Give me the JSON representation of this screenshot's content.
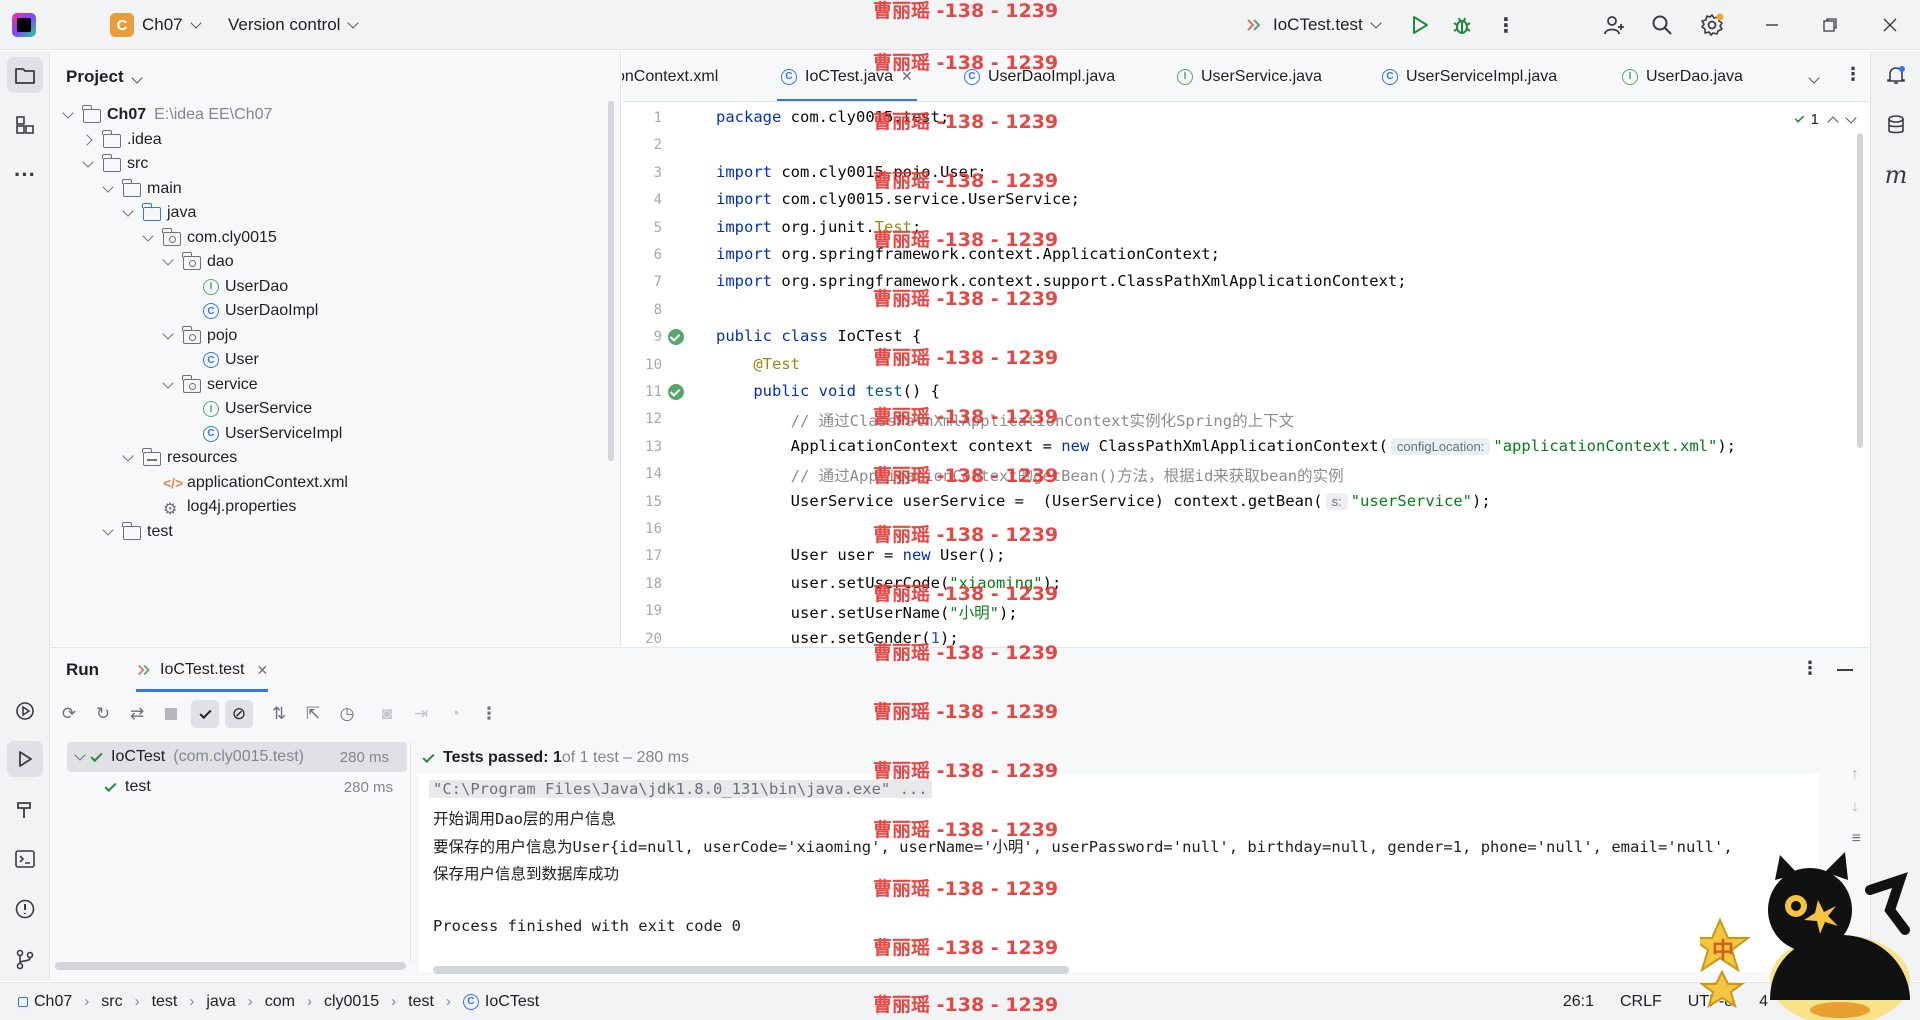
{
  "titlebar": {
    "project_badge": "C",
    "project_name": "Ch07",
    "vcs_label": "Version control",
    "run_config": "IoCTest.test"
  },
  "project_panel": {
    "title": "Project",
    "tree": [
      {
        "label": "Ch07",
        "extra": "E:\\idea EE\\Ch07",
        "icon": "folder",
        "expanded": true,
        "depth": 0
      },
      {
        "label": ".idea",
        "icon": "folder",
        "expanded": false,
        "depth": 1
      },
      {
        "label": "src",
        "icon": "folder",
        "expanded": true,
        "depth": 1
      },
      {
        "label": "main",
        "icon": "folder",
        "expanded": true,
        "depth": 2
      },
      {
        "label": "java",
        "icon": "folder-blue",
        "expanded": true,
        "depth": 3
      },
      {
        "label": "com.cly0015",
        "icon": "package",
        "expanded": true,
        "depth": 4
      },
      {
        "label": "dao",
        "icon": "package",
        "expanded": true,
        "depth": 5
      },
      {
        "label": "UserDao",
        "icon": "interface",
        "depth": 6
      },
      {
        "label": "UserDaoImpl",
        "icon": "class",
        "depth": 6
      },
      {
        "label": "pojo",
        "icon": "package",
        "expanded": true,
        "depth": 5
      },
      {
        "label": "User",
        "icon": "class",
        "depth": 6
      },
      {
        "label": "service",
        "icon": "package",
        "expanded": true,
        "depth": 5
      },
      {
        "label": "UserService",
        "icon": "interface",
        "depth": 6
      },
      {
        "label": "UserServiceImpl",
        "icon": "class",
        "depth": 6
      },
      {
        "label": "resources",
        "icon": "resources",
        "expanded": true,
        "depth": 3
      },
      {
        "label": "applicationContext.xml",
        "icon": "xml",
        "depth": 4
      },
      {
        "label": "log4j.properties",
        "icon": "gear",
        "depth": 4
      },
      {
        "label": "test",
        "icon": "folder",
        "expanded": true,
        "depth": 2
      }
    ]
  },
  "editor_tabs": [
    {
      "label": "onContext.xml",
      "icon": "xml",
      "active": false
    },
    {
      "label": "IoCTest.java",
      "icon": "class",
      "active": true
    },
    {
      "label": "UserDaoImpl.java",
      "icon": "class",
      "active": false
    },
    {
      "label": "UserService.java",
      "icon": "interface",
      "active": false
    },
    {
      "label": "UserServiceImpl.java",
      "icon": "class",
      "active": false
    },
    {
      "label": "UserDao.java",
      "icon": "interface",
      "active": false
    }
  ],
  "editor": {
    "inspection_count": "1",
    "line_numbers": [
      "1",
      "2",
      "3",
      "4",
      "5",
      "6",
      "7",
      "8",
      "9",
      "10",
      "11",
      "12",
      "13",
      "14",
      "15",
      "16",
      "17",
      "18",
      "19",
      "20"
    ],
    "lines": [
      {
        "indent": 0,
        "tokens": [
          {
            "t": "kw",
            "v": "package"
          },
          {
            "t": "p",
            "v": " com.cly0015.test;"
          }
        ]
      },
      {
        "indent": 0,
        "tokens": []
      },
      {
        "indent": 0,
        "tokens": [
          {
            "t": "kw",
            "v": "import"
          },
          {
            "t": "p",
            "v": " com.cly0015.pojo.User;"
          }
        ]
      },
      {
        "indent": 0,
        "tokens": [
          {
            "t": "kw",
            "v": "import"
          },
          {
            "t": "p",
            "v": " com.cly0015.service.UserService;"
          }
        ]
      },
      {
        "indent": 0,
        "tokens": [
          {
            "t": "kw",
            "v": "import"
          },
          {
            "t": "p",
            "v": " org.junit."
          },
          {
            "t": "ann",
            "v": "Test"
          },
          {
            "t": "p",
            "v": ";"
          }
        ]
      },
      {
        "indent": 0,
        "tokens": [
          {
            "t": "kw",
            "v": "import"
          },
          {
            "t": "p",
            "v": " org.springframework.context.ApplicationContext;"
          }
        ]
      },
      {
        "indent": 0,
        "tokens": [
          {
            "t": "kw",
            "v": "import"
          },
          {
            "t": "p",
            "v": " org.springframework.context.support.ClassPathXmlApplicationContext;"
          }
        ]
      },
      {
        "indent": 0,
        "tokens": []
      },
      {
        "indent": 0,
        "tokens": [
          {
            "t": "kw",
            "v": "public class"
          },
          {
            "t": "p",
            "v": " IoCTest {"
          }
        ]
      },
      {
        "indent": 1,
        "tokens": [
          {
            "t": "ann",
            "v": "@Test"
          }
        ]
      },
      {
        "indent": 1,
        "tokens": [
          {
            "t": "kw",
            "v": "public void"
          },
          {
            "t": "p",
            "v": " "
          },
          {
            "t": "fn",
            "v": "test"
          },
          {
            "t": "p",
            "v": "() {"
          }
        ]
      },
      {
        "indent": 2,
        "tokens": [
          {
            "t": "cmt",
            "v": "// 通过ClassPathXmlApplicationContext实例化Spring的上下文"
          }
        ]
      },
      {
        "indent": 2,
        "tokens": [
          {
            "t": "p",
            "v": "ApplicationContext context = "
          },
          {
            "t": "kw",
            "v": "new"
          },
          {
            "t": "p",
            "v": " ClassPathXmlApplicationContext("
          },
          {
            "t": "hint",
            "v": "configLocation:"
          },
          {
            "t": "str",
            "v": "\"applicationContext.xml\""
          },
          {
            "t": "p",
            "v": ");"
          }
        ]
      },
      {
        "indent": 2,
        "tokens": [
          {
            "t": "cmt",
            "v": "// 通过ApplicationContext的getBean()方法，根据id来获取bean的实例"
          }
        ]
      },
      {
        "indent": 2,
        "tokens": [
          {
            "t": "p",
            "v": "UserService userService =  (UserService) context.getBean("
          },
          {
            "t": "hint",
            "v": "s:"
          },
          {
            "t": "str",
            "v": "\"userService\""
          },
          {
            "t": "p",
            "v": ");"
          }
        ]
      },
      {
        "indent": 0,
        "tokens": []
      },
      {
        "indent": 2,
        "tokens": [
          {
            "t": "p",
            "v": "User user = "
          },
          {
            "t": "kw",
            "v": "new"
          },
          {
            "t": "p",
            "v": " User();"
          }
        ]
      },
      {
        "indent": 2,
        "tokens": [
          {
            "t": "p",
            "v": "user.setUserCode("
          },
          {
            "t": "str",
            "v": "\"xiaoming\""
          },
          {
            "t": "p",
            "v": ");"
          }
        ]
      },
      {
        "indent": 2,
        "tokens": [
          {
            "t": "p",
            "v": "user.setUserName("
          },
          {
            "t": "str",
            "v": "\"小明\""
          },
          {
            "t": "p",
            "v": ");"
          }
        ]
      },
      {
        "indent": 2,
        "tokens": [
          {
            "t": "p",
            "v": "user.setGender("
          },
          {
            "t": "num",
            "v": "1"
          },
          {
            "t": "p",
            "v": ");"
          }
        ]
      }
    ]
  },
  "run_panel": {
    "title": "Run",
    "tab_label": "IoCTest.test",
    "results": [
      {
        "name": "IoCTest",
        "detail": "(com.cly0015.test)",
        "duration": "280 ms"
      },
      {
        "name": "test",
        "detail": "",
        "duration": "280 ms"
      }
    ],
    "summary_bold": "Tests passed: 1",
    "summary_rest": " of 1 test – 280 ms",
    "console": [
      "\"C:\\Program Files\\Java\\jdk1.8.0_131\\bin\\java.exe\" ...",
      "开始调用Dao层的用户信息",
      "要保存的用户信息为User{id=null, userCode='xiaoming', userName='小明', userPassword='null', birthday=null, gender=1, phone='null', email='null',",
      "保存用户信息到数据库成功",
      "",
      "Process finished with exit code 0"
    ]
  },
  "statusbar": {
    "breadcrumb": [
      "Ch07",
      "src",
      "test",
      "java",
      "com",
      "cly0015",
      "test",
      "IoCTest"
    ],
    "position": "26:1",
    "line_sep": "CRLF",
    "encoding": "UTF-8",
    "indent": "4"
  },
  "watermark": "曹丽瑶 -138 - 1239",
  "mascot_badge": "中",
  "colors": {
    "accent": "#3574f0",
    "watermark": "#e53935",
    "pass": "#208a3c",
    "keyword": "#0033b3",
    "string": "#067d17"
  }
}
